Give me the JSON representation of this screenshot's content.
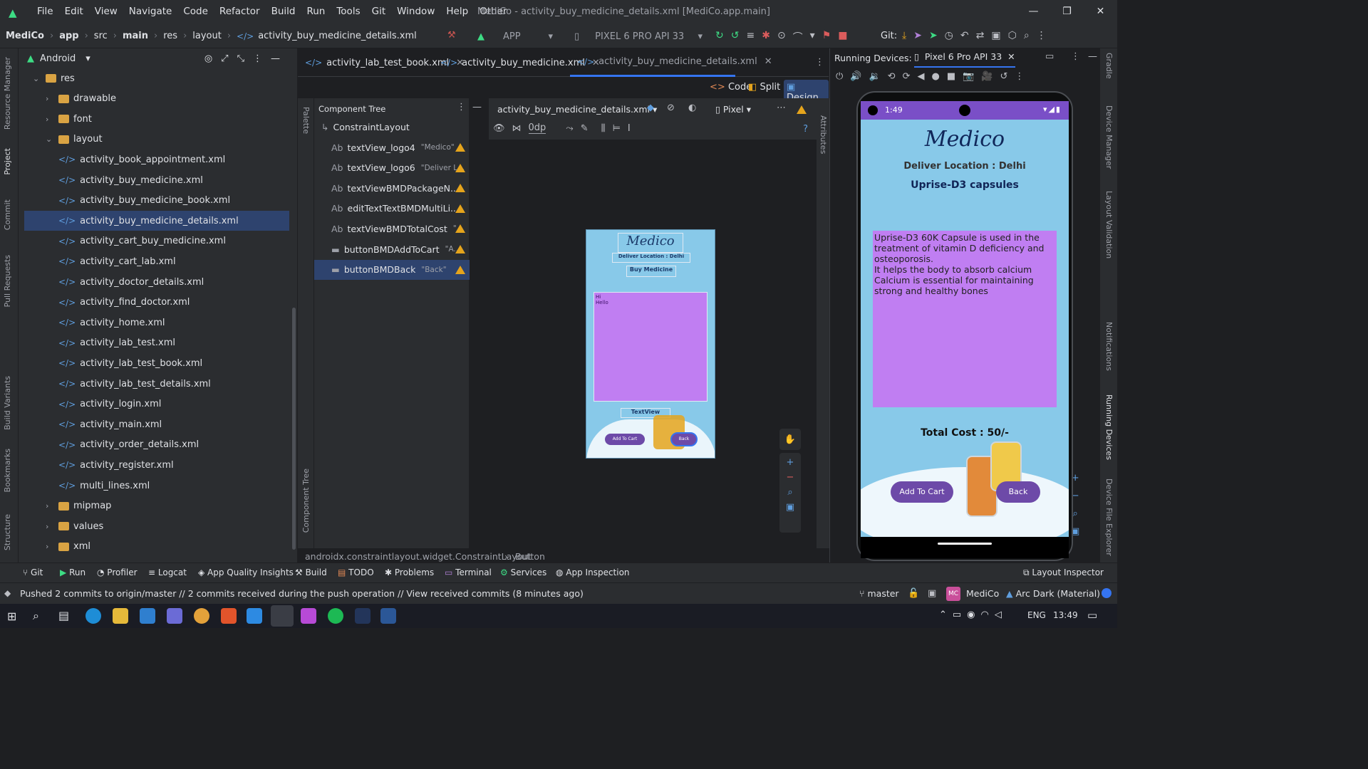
{
  "menu": [
    "File",
    "Edit",
    "View",
    "Navigate",
    "Code",
    "Refactor",
    "Build",
    "Run",
    "Tools",
    "Git",
    "Window",
    "Help",
    "Other"
  ],
  "window_title": "MediCo - activity_buy_medicine_details.xml [MediCo.app.main]",
  "breadcrumb": {
    "project": "MediCo",
    "app": "app",
    "src": "src",
    "main": "main",
    "res": "res",
    "layout": "layout",
    "file": "activity_buy_medicine_details.xml"
  },
  "toolbar": {
    "run_config": "APP",
    "device": "PIXEL 6 PRO API 33",
    "git_label": "Git:"
  },
  "project_panel": {
    "view_label": "Android",
    "items": [
      {
        "label": "res",
        "type": "folder",
        "open": true,
        "level": 0
      },
      {
        "label": "drawable",
        "type": "folder",
        "open": false,
        "level": 1
      },
      {
        "label": "font",
        "type": "folder",
        "open": false,
        "level": 1
      },
      {
        "label": "layout",
        "type": "folder",
        "open": true,
        "level": 1
      },
      {
        "label": "activity_book_appointment.xml",
        "type": "file",
        "level": 2
      },
      {
        "label": "activity_buy_medicine.xml",
        "type": "file",
        "level": 2
      },
      {
        "label": "activity_buy_medicine_book.xml",
        "type": "file",
        "level": 2
      },
      {
        "label": "activity_buy_medicine_details.xml",
        "type": "file",
        "level": 2,
        "selected": true
      },
      {
        "label": "activity_cart_buy_medicine.xml",
        "type": "file",
        "level": 2
      },
      {
        "label": "activity_cart_lab.xml",
        "type": "file",
        "level": 2
      },
      {
        "label": "activity_doctor_details.xml",
        "type": "file",
        "level": 2
      },
      {
        "label": "activity_find_doctor.xml",
        "type": "file",
        "level": 2
      },
      {
        "label": "activity_home.xml",
        "type": "file",
        "level": 2
      },
      {
        "label": "activity_lab_test.xml",
        "type": "file",
        "level": 2
      },
      {
        "label": "activity_lab_test_book.xml",
        "type": "file",
        "level": 2
      },
      {
        "label": "activity_lab_test_details.xml",
        "type": "file",
        "level": 2
      },
      {
        "label": "activity_login.xml",
        "type": "file",
        "level": 2
      },
      {
        "label": "activity_main.xml",
        "type": "file",
        "level": 2
      },
      {
        "label": "activity_order_details.xml",
        "type": "file",
        "level": 2
      },
      {
        "label": "activity_register.xml",
        "type": "file",
        "level": 2
      },
      {
        "label": "multi_lines.xml",
        "type": "file",
        "level": 2
      },
      {
        "label": "mipmap",
        "type": "folder",
        "open": false,
        "level": 1
      },
      {
        "label": "values",
        "type": "folder",
        "open": false,
        "level": 1
      },
      {
        "label": "xml",
        "type": "folder",
        "open": false,
        "level": 1
      }
    ]
  },
  "left_strip": [
    "Resource Manager",
    "Project",
    "Commit",
    "Pull Requests",
    "Build Variants",
    "Bookmarks",
    "Structure"
  ],
  "right_strip": [
    "Gradle",
    "Device Manager",
    "Layout Validation",
    "Notifications",
    "Running Devices",
    "Device File Explorer"
  ],
  "editor_tabs": [
    {
      "label": "activity_lab_test_book.xml",
      "active": false
    },
    {
      "label": "activity_buy_medicine.xml",
      "active": false
    },
    {
      "label": "activity_buy_medicine_details.xml",
      "active": true
    }
  ],
  "modes": {
    "code": "Code",
    "split": "Split",
    "design": "Design"
  },
  "component_tree": {
    "title": "Component Tree",
    "root": "ConstraintLayout",
    "items": [
      {
        "prefix": "Ab",
        "id": "textView_logo4",
        "hint": "\"Medico\""
      },
      {
        "prefix": "Ab",
        "id": "textView_logo6",
        "hint": "\"Deliver L..."
      },
      {
        "prefix": "Ab",
        "id": "textViewBMDPackageN...",
        "hint": ""
      },
      {
        "prefix": "Ab",
        "id": "editTextTextBMDMultiLi...",
        "hint": ""
      },
      {
        "prefix": "Ab",
        "id": "textViewBMDTotalCost",
        "hint": "\"..."
      },
      {
        "prefix": "btn",
        "id": "buttonBMDAddToCart",
        "hint": "\"A..."
      },
      {
        "prefix": "btn",
        "id": "buttonBMDBack",
        "hint": "\"Back\"",
        "selected": true
      }
    ]
  },
  "design_toolbar": {
    "file": "activity_buy_medicine_details.xml",
    "device": "Pixel",
    "margin": "0dp"
  },
  "palette_label": "Palette",
  "comp_tree_side_label": "Component Tree",
  "attributes_label": "Attributes",
  "preview": {
    "logo": "Medico",
    "location": "Deliver Location : Delhi",
    "package": "Buy Medicine",
    "text": "Hi\nHello",
    "total": "TextView",
    "add": "Add To Cart",
    "back": "Back"
  },
  "running": {
    "label": "Running Devices:",
    "device_tab": "Pixel 6 Pro API 33"
  },
  "phone": {
    "time": "1:49",
    "logo": "Medico",
    "location": "Deliver Location : Delhi",
    "package": "Uprise-D3 capsules",
    "details": "Uprise-D3 60K Capsule is used in the treatment of vitamin D deficiency and osteoporosis.\nIt helps the body to absorb calcium\nCalcium is essential for maintaining strong and healthy bones",
    "total": "Total Cost : 50/-",
    "add_button": "Add To Cart",
    "back_button": "Back"
  },
  "class_breadcrumb": {
    "class": "androidx.constraintlayout.widget.ConstraintLayout",
    "element": "Button"
  },
  "bottom_tools": [
    "Git",
    "Run",
    "Profiler",
    "Logcat",
    "App Quality Insights",
    "Build",
    "TODO",
    "Problems",
    "Terminal",
    "Services",
    "App Inspection"
  ],
  "layout_inspector": "Layout Inspector",
  "status": {
    "message": "Pushed 2 commits to origin/master // 2 commits received during the push operation // View received commits (8 minutes ago)",
    "branch": "master",
    "project": "MediCo",
    "project_badge": "MC",
    "theme": "Arc Dark (Material)"
  },
  "taskbar": {
    "lang": "ENG",
    "time": "13:49"
  },
  "colors": {
    "accent": "#3574f0",
    "preview_bg": "#88c9e9",
    "purple_box": "#c07ef2",
    "button": "#6d4aa8",
    "status_bar": "#7a4fc7",
    "warning": "#e5a41c"
  }
}
